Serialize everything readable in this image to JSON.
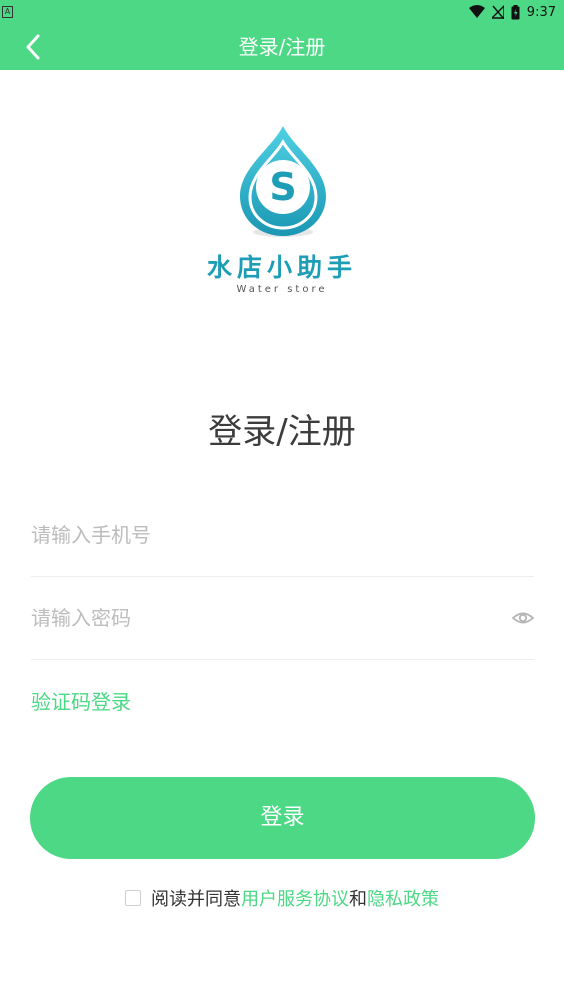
{
  "status_bar": {
    "left_icon": "A",
    "icons": [
      "wifi-icon",
      "signal-off-icon",
      "battery-icon"
    ],
    "time": "9:37"
  },
  "app_bar": {
    "title": "登录/注册",
    "back_icon": "chevron-left-icon"
  },
  "logo": {
    "mark_letter": "S",
    "name": "水店小助手",
    "subtitle": "Water store"
  },
  "heading": "登录/注册",
  "form": {
    "phone_placeholder": "请输入手机号",
    "phone_value": "",
    "password_placeholder": "请输入密码",
    "password_value": "",
    "eye_icon": "eye-icon",
    "sms_login_label": "验证码登录",
    "submit_label": "登录"
  },
  "agreement": {
    "checked": false,
    "prefix": "阅读并同意",
    "terms_link": "用户服务协议",
    "conjunction": "和",
    "privacy_link": "隐私政策"
  },
  "colors": {
    "accent": "#4cd884",
    "logo_blue": "#1e9db6",
    "placeholder": "#bcbcbc"
  }
}
